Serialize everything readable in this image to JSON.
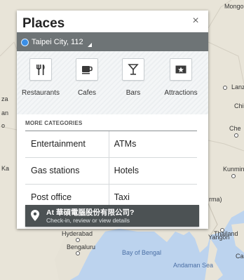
{
  "map": {
    "labels": {
      "mongolia": "Mongo",
      "lanzhou": "Lanz",
      "chi": "Chi",
      "che": "Che",
      "kunming": "Kunmin",
      "myanmar": "rma)",
      "yangon": "Yangon",
      "thailand": "Thailand",
      "hyderabad": "Hyderabad",
      "bengaluru": "Bengaluru",
      "bay_of_bengal": "Bay of Bengal",
      "andaman_sea": "Andaman Sea",
      "cai": "Ca",
      "left_a": "za",
      "left_b": "an",
      "left_c": "o",
      "left_d": "Ka"
    }
  },
  "panel": {
    "title": "Places",
    "close_symbol": "×",
    "location": "Taipei City, 112",
    "categories": [
      {
        "label": "Restaurants",
        "icon": "restaurant-icon"
      },
      {
        "label": "Cafes",
        "icon": "cafe-icon"
      },
      {
        "label": "Bars",
        "icon": "bar-icon"
      },
      {
        "label": "Attractions",
        "icon": "attractions-icon"
      }
    ],
    "more_title": "MORE CATEGORIES",
    "more": [
      [
        "Entertainment",
        "ATMs"
      ],
      [
        "Gas stations",
        "Hotels"
      ],
      [
        "Post office",
        "Taxi"
      ]
    ]
  },
  "checkin": {
    "main": "At 華碩電腦股份有限公司?",
    "sub": "Check-in, review or view details"
  },
  "colors": {
    "location_bar": "#6e7476",
    "checkin_bar": "#4c5254",
    "water": "#bcd3ee",
    "land": "#e8e4d8"
  }
}
